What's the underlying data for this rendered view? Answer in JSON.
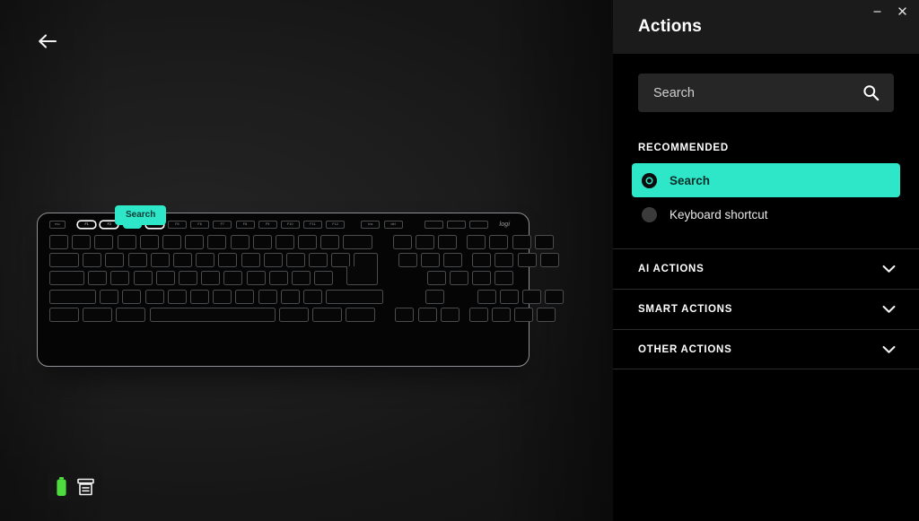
{
  "window": {
    "minimize_label": "–",
    "close_label": "×"
  },
  "panel": {
    "title": "Actions",
    "search": {
      "placeholder": "Search",
      "value": "",
      "icon": "search-icon"
    },
    "recommended_label": "RECOMMENDED",
    "options": [
      {
        "label": "Search",
        "selected": true
      },
      {
        "label": "Keyboard shortcut",
        "selected": false
      }
    ],
    "sections": [
      {
        "label": "AI ACTIONS",
        "expanded": false,
        "icon": "chevron-down-icon"
      },
      {
        "label": "SMART ACTIONS",
        "expanded": false,
        "icon": "chevron-down-icon"
      },
      {
        "label": "OTHER ACTIONS",
        "expanded": false,
        "icon": "chevron-down-icon"
      }
    ]
  },
  "stage": {
    "back_icon": "arrow-left-icon",
    "tooltip": "Search",
    "brand": "logi",
    "status": {
      "battery_icon": "battery-icon",
      "battery_color": "#4ddb3f",
      "device_icon": "device-stack-icon"
    }
  },
  "keyboard": {
    "function_row": [
      {
        "label": "esc",
        "state": "plain",
        "kind": "esc"
      },
      {
        "label": "F1",
        "state": "outlined"
      },
      {
        "label": "F2",
        "state": "outlined"
      },
      {
        "label": "F3",
        "state": "active"
      },
      {
        "label": "F4",
        "state": "outlined"
      },
      {
        "label": "F5",
        "state": "plain"
      },
      {
        "label": "F6",
        "state": "plain"
      },
      {
        "label": "F7",
        "state": "plain"
      },
      {
        "label": "F8",
        "state": "plain"
      },
      {
        "label": "F9",
        "state": "plain"
      },
      {
        "label": "F10",
        "state": "plain"
      },
      {
        "label": "F11",
        "state": "plain"
      },
      {
        "label": "F12",
        "state": "plain"
      },
      {
        "label": "ins",
        "state": "plain"
      },
      {
        "label": "del",
        "state": "plain"
      },
      {
        "label": "",
        "state": "blank"
      },
      {
        "label": "",
        "state": "blank"
      },
      {
        "label": "",
        "state": "blank"
      }
    ]
  },
  "colors": {
    "accent": "#2ee6c8",
    "panel_bg": "#000000",
    "panel_header_bg": "#1b1b1b",
    "search_bg": "#262626",
    "key_outline": "#4a4d50",
    "keyboard_border": "#8e9195"
  }
}
